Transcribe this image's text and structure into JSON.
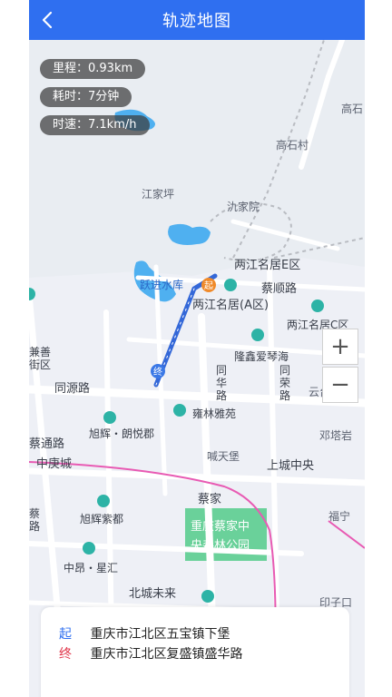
{
  "header": {
    "title": "轨迹地图"
  },
  "stats": {
    "distance": "里程：0.93km",
    "duration": "耗时：7分钟",
    "speed": "时速：7.1km/h"
  },
  "zoom": {
    "in_label": "+",
    "out_label": "−"
  },
  "route": {
    "start_tag": "起",
    "start_address": "重庆市江北区五宝镇下堡",
    "end_tag": "终",
    "end_address": "重庆市江北区复盛镇盛华路"
  },
  "markers": {
    "start": "起",
    "end": "终"
  },
  "map_labels": {
    "gaoshi": "高石",
    "gaoshicun": "高石村",
    "jiangjiaping": "江家坪",
    "longjiayuan": "氿家院",
    "liangjiang_e_district": "两江名居E区",
    "yuejin_reservoir": "跃进水库",
    "chongshun_road": "蔡顺路",
    "liangjiang_a_district": "两江名居(A区)",
    "liangjiang_c_district": "两江名居C区",
    "longxin_piano": "隆鑫爱琴海",
    "jianshan_district": "兼善\n街区",
    "tongyuan_road": "同源路",
    "tonghua_road": "同\n华\n路",
    "tongrong_road": "同\n荣\n路",
    "yunyuguan": "云台观",
    "xuhui_langyuejun": "旭辉・朗悦郡",
    "yonglinyayuan": "雍林雅苑",
    "dengtayan": "邓塔岩",
    "caitong_road": "蔡通路",
    "hantianbao": "喊天堡",
    "zhongqing_city": "中庚城",
    "shangcheng_zhongyang": "上城中央",
    "caijia": "蔡家",
    "xuhui_zidu": "旭辉紫都",
    "funing": "福宁",
    "park": "重庆蔡家中\n央森林公园",
    "zhongang_xinghui": "中昂・星汇",
    "beicheng_weilai": "北城未来",
    "yinzi_qi": "印子口",
    "chongyinzi": "蔡\n路"
  }
}
